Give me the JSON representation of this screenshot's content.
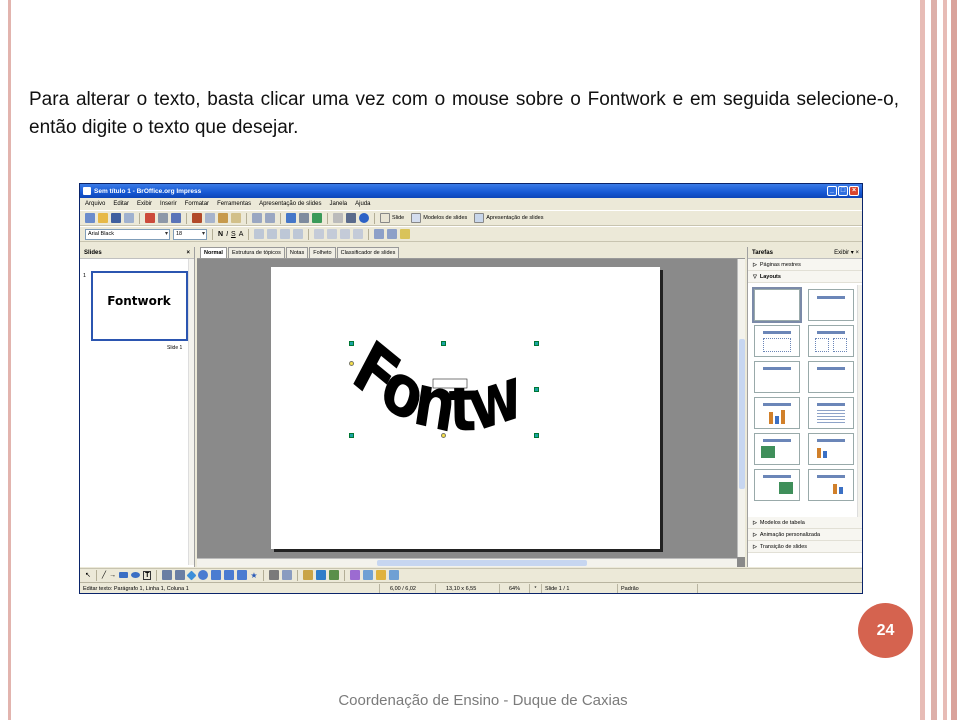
{
  "caption": "Para alterar o texto, basta clicar uma vez com o mouse sobre o Fontwork e em seguida selecione-o, então digite o texto que desejar.",
  "page_number": "24",
  "footer": "Coordenação de Ensino - Duque de Caxias",
  "window": {
    "title": "Sem título 1 - BrOffice.org Impress",
    "menu": [
      "Arquivo",
      "Editar",
      "Exibir",
      "Inserir",
      "Formatar",
      "Ferramentas",
      "Apresentação de slides",
      "Janela",
      "Ajuda"
    ],
    "toolbar_labels": {
      "slide": "Slide",
      "models": "Modelos de slides",
      "presentation": "Apresentação de slides"
    },
    "font_name": "Arial Black",
    "font_size": "18"
  },
  "slides_pane": {
    "title": "Slides",
    "slide_number": "1",
    "slide_label": "Slide 1",
    "thumb_text": "Fontwork"
  },
  "tabs": [
    "Normal",
    "Estrutura de tópicos",
    "Notas",
    "Folheto",
    "Classificador de slides"
  ],
  "fontwork_text": "Fontwork",
  "task_pane": {
    "title": "Tarefas",
    "view_label": "Exibir",
    "sections_top": [
      "Páginas mestres",
      "Layouts"
    ],
    "sections_bottom": [
      "Modelos de tabela",
      "Animação personalizada",
      "Transição de slides"
    ]
  },
  "status": {
    "edit_text": "Editar texto: Parágrafo 1, Linha 1, Coluna 1",
    "position": "6,00 / 6,02",
    "size": "13,10 x 6,55",
    "zoom": "64%",
    "slide": "Slide 1 / 1",
    "layout": "Padrão"
  },
  "colors": {
    "accent_badge": "#d5634f",
    "frame_stripe": "#e2b4ae",
    "title_bar": "#1658d4"
  }
}
